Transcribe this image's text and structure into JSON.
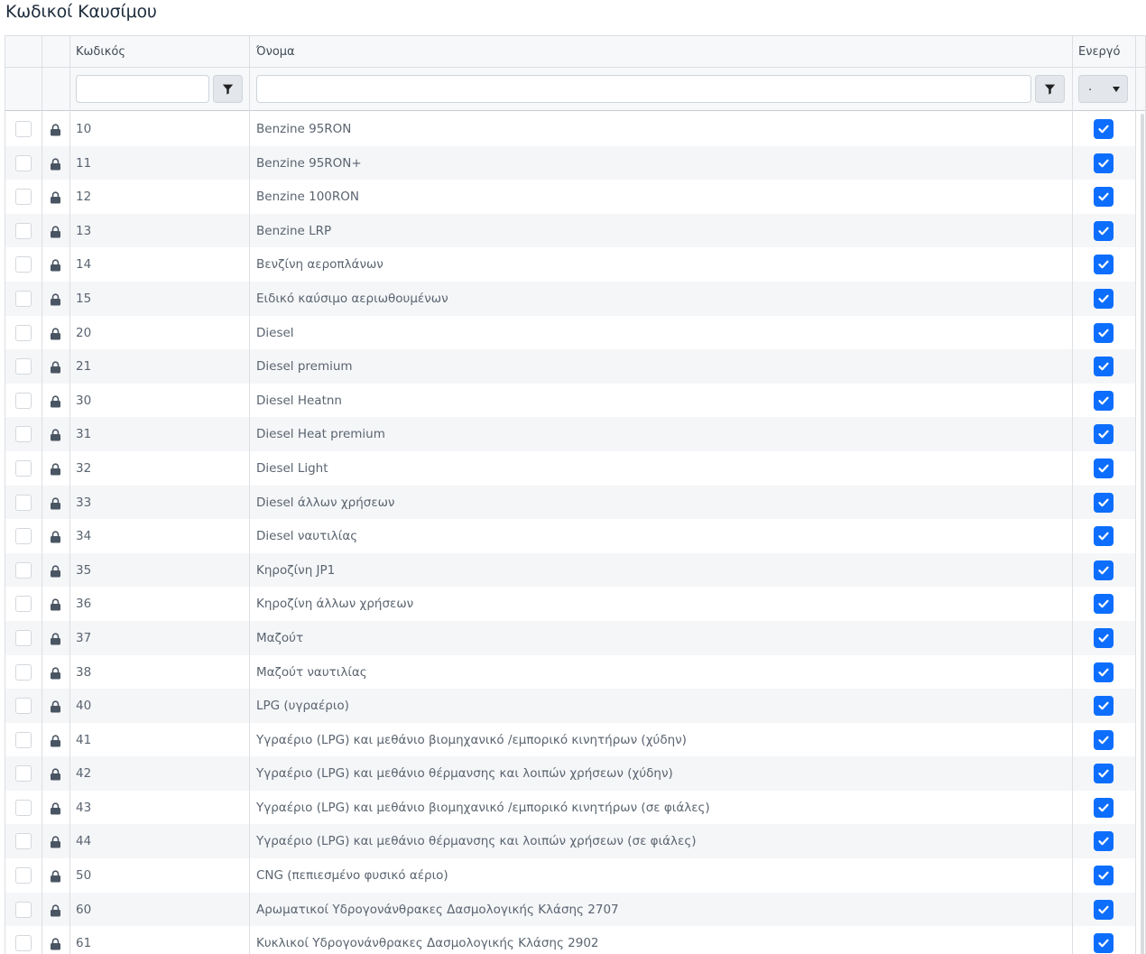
{
  "page": {
    "title": "Κωδικοί Καυσίμου"
  },
  "columns": {
    "code": "Κωδικός",
    "name": "Όνομα",
    "active": "Ενεργό"
  },
  "filters": {
    "active_select_value": "."
  },
  "colors": {
    "accent": "#0d6efd",
    "row_alt": "#f5f6f8",
    "border": "#dcdfe3"
  },
  "rows": [
    {
      "code": "10",
      "name": "Benzine 95RON",
      "active": true
    },
    {
      "code": "11",
      "name": "Benzine 95RON+",
      "active": true
    },
    {
      "code": "12",
      "name": "Benzine 100RON",
      "active": true
    },
    {
      "code": "13",
      "name": "Benzine LRP",
      "active": true
    },
    {
      "code": "14",
      "name": "Βενζίνη αεροπλάνων",
      "active": true
    },
    {
      "code": "15",
      "name": "Ειδικό καύσιμο αεριωθουμένων",
      "active": true
    },
    {
      "code": "20",
      "name": "Diesel",
      "active": true
    },
    {
      "code": "21",
      "name": "Diesel premium",
      "active": true
    },
    {
      "code": "30",
      "name": "Diesel Heatnn",
      "active": true
    },
    {
      "code": "31",
      "name": "Diesel Heat premium",
      "active": true
    },
    {
      "code": "32",
      "name": "Diesel Light",
      "active": true
    },
    {
      "code": "33",
      "name": "Diesel άλλων χρήσεων",
      "active": true
    },
    {
      "code": "34",
      "name": "Diesel ναυτιλίας",
      "active": true
    },
    {
      "code": "35",
      "name": "Κηροζίνη JP1",
      "active": true
    },
    {
      "code": "36",
      "name": "Κηροζίνη άλλων χρήσεων",
      "active": true
    },
    {
      "code": "37",
      "name": "Μαζούτ",
      "active": true
    },
    {
      "code": "38",
      "name": "Μαζούτ ναυτιλίας",
      "active": true
    },
    {
      "code": "40",
      "name": "LPG (υγραέριο)",
      "active": true
    },
    {
      "code": "41",
      "name": "Υγραέριο (LPG) και μεθάνιο βιομηχανικό /εμπορικό κινητήρων (χύδην)",
      "active": true
    },
    {
      "code": "42",
      "name": "Υγραέριο (LPG) και μεθάνιο θέρμανσης και λοιπών χρήσεων (χύδην)",
      "active": true
    },
    {
      "code": "43",
      "name": "Υγραέριο (LPG) και μεθάνιο βιομηχανικό /εμπορικό κινητήρων (σε φιάλες)",
      "active": true
    },
    {
      "code": "44",
      "name": "Υγραέριο (LPG) και μεθάνιο θέρμανσης και λοιπών χρήσεων (σε φιάλες)",
      "active": true
    },
    {
      "code": "50",
      "name": "CNG (πεπιεσμένο φυσικό αέριο)",
      "active": true
    },
    {
      "code": "60",
      "name": "Αρωματικοί Υδρογονάνθρακες Δασμολογικής Κλάσης 2707",
      "active": true
    },
    {
      "code": "61",
      "name": "Κυκλικοί Υδρογονάνθρακες Δασμολογικής Κλάσης 2902",
      "active": true
    }
  ]
}
